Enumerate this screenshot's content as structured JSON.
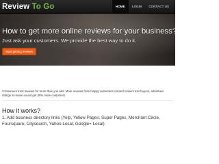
{
  "navbar": {
    "brand_main": "Review",
    "brand_accent": " To Go",
    "items": [
      {
        "label": "HOME"
      },
      {
        "label": "LOGIN"
      },
      {
        "label": "CONTACT US"
      }
    ]
  },
  "hero": {
    "title": "How to get more online reviews for your business?",
    "subtitle": "Just ask your customers. We provide the best way to do it.",
    "button_label": "Start getting reviews"
  },
  "intro": {
    "text": "Consumers trust reviews for more than you ads. More reviews from Happy customers convert lookers into buyers, advertiser ratings increase sound get 30% more customers."
  },
  "how": {
    "title": "How it works?",
    "steps": [
      "1. Add business directory links (Yelp, Yellow Pages, Super Pages, Merchant Circle,",
      "Foursquare, Citysearch, Yahoo Local, Google+ Local)"
    ]
  },
  "colors": {
    "accent_green": "#7ab648",
    "cta_orange": "#e85d18",
    "navbar": "#1c1c1c"
  }
}
